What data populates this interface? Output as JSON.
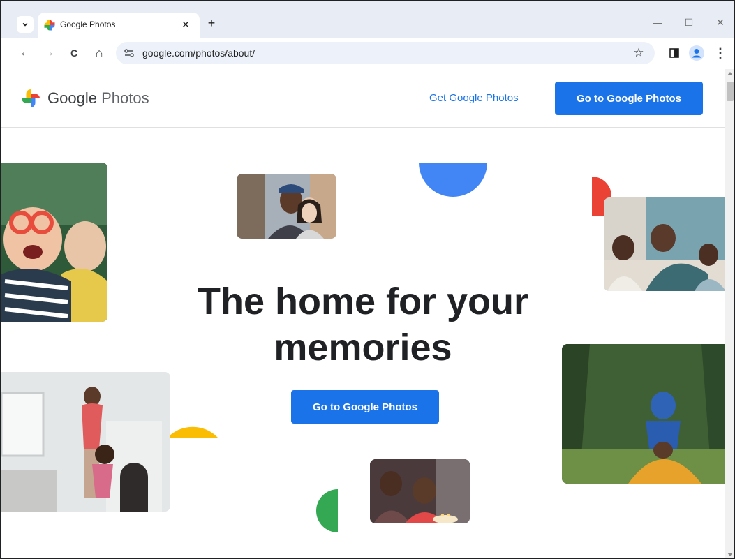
{
  "browser": {
    "tab": {
      "title": "Google Photos",
      "close": "✕"
    },
    "new_tab": "+",
    "window_controls": {
      "minimize": "—",
      "maximize": "☐",
      "close": "✕"
    },
    "toolbar": {
      "back": "←",
      "forward": "→",
      "reload": "C",
      "home": "⌂",
      "star": "☆",
      "menu": "⋮"
    },
    "omnibox": {
      "url": "google.com/photos/about/"
    }
  },
  "site": {
    "logo": {
      "google": "Google",
      "photos": "Photos"
    },
    "nav": {
      "get_link": "Get Google Photos",
      "go_button": "Go to Google Photos"
    },
    "hero": {
      "title_line1": "The home for your",
      "title_line2": "memories",
      "cta": "Go to Google Photos"
    }
  },
  "colors": {
    "brand_blue": "#1a73e8",
    "shape_blue": "#4285f4",
    "shape_red": "#ea4335",
    "shape_yellow": "#fbbc04",
    "shape_green": "#34a853"
  }
}
